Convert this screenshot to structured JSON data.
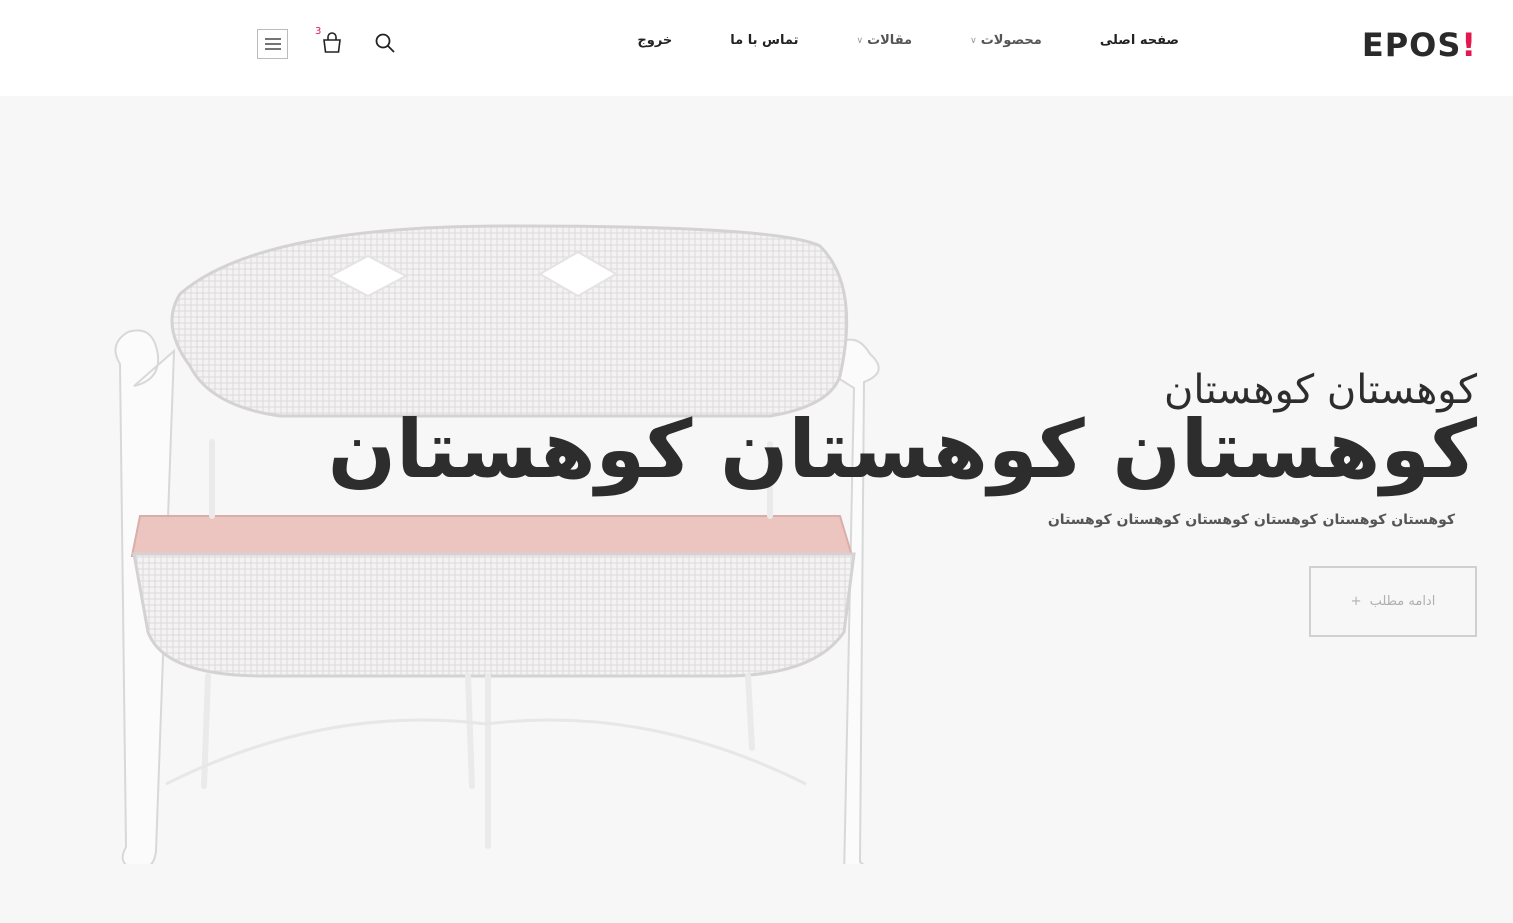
{
  "header": {
    "logo_text": "EPOS",
    "logo_dot": "!",
    "nav": [
      {
        "label": "صفحه اصلی",
        "has_dropdown": false
      },
      {
        "label": "محصولات",
        "has_dropdown": true
      },
      {
        "label": "مقالات",
        "has_dropdown": true
      },
      {
        "label": "تماس با ما",
        "has_dropdown": false
      },
      {
        "label": "خروج",
        "has_dropdown": false
      }
    ],
    "cart_count": "3",
    "icons": {
      "search": "search-icon",
      "cart": "shopping-bag-icon",
      "menu": "hamburger-menu-icon"
    }
  },
  "hero": {
    "subtitle": "کوهستان کوهستان",
    "title": "کوهستان کوهستان کوهستان",
    "description": "کوهستان کوهستان کوهستان کوهستان کوهستان کوهستان",
    "button_label": "ادامه مطلب",
    "button_icon": "plus-icon",
    "image": "white-wicker-bench-with-pink-cushion"
  },
  "colors": {
    "accent": "#e4184f",
    "background": "#f7f7f7",
    "text": "#2d2d2d",
    "cushion": "#ecc5c0"
  }
}
